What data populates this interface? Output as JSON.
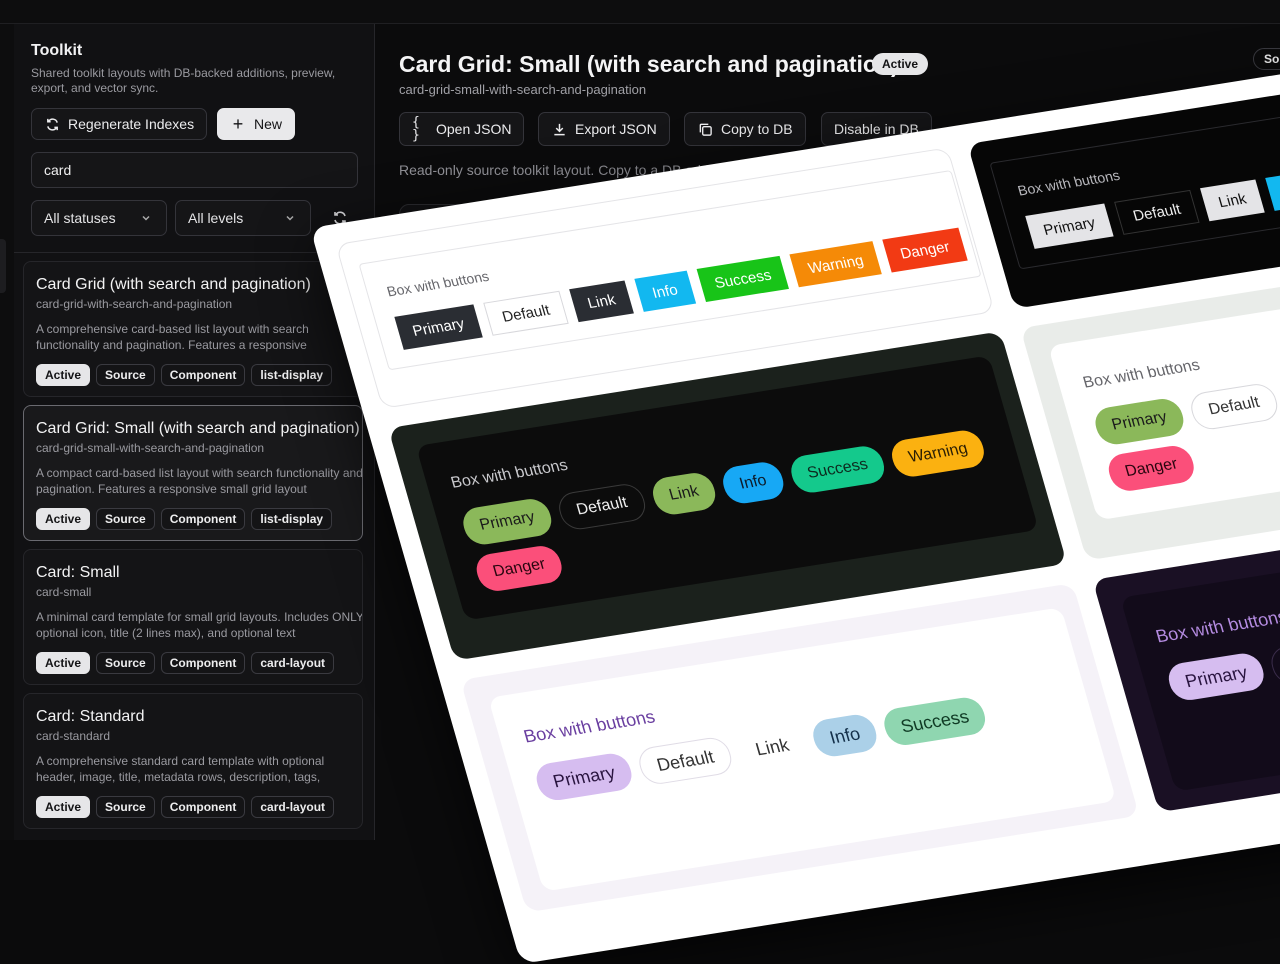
{
  "sidebar": {
    "title": "Toolkit",
    "description": "Shared toolkit layouts with DB-backed additions, preview, export, and vector sync.",
    "regenerate_label": "Regenerate Indexes",
    "new_label": "New",
    "search_value": "card",
    "status_filter": "All statuses",
    "level_filter": "All levels",
    "items": [
      {
        "title": "Card Grid (with search and pagination)",
        "slug": "card-grid-with-search-and-pagination",
        "desc": "A comprehensive card-based list layout with search functionality and pagination. Features a responsive",
        "tags": [
          "Active",
          "Source",
          "Component",
          "list-display"
        ]
      },
      {
        "title": "Card Grid: Small (with search and pagination)",
        "slug": "card-grid-small-with-search-and-pagination",
        "desc": "A compact card-based list layout with search functionality and pagination. Features a responsive small grid layout",
        "tags": [
          "Active",
          "Source",
          "Component",
          "list-display"
        ]
      },
      {
        "title": "Card: Small",
        "slug": "card-small",
        "desc": "A minimal card template for small grid layouts. Includes ONLY optional icon, title (2 lines max), and optional text",
        "tags": [
          "Active",
          "Source",
          "Component",
          "card-layout"
        ]
      },
      {
        "title": "Card: Standard",
        "slug": "card-standard",
        "desc": "A comprehensive standard card template with optional header, image, title, metadata rows, description, tags,",
        "tags": [
          "Active",
          "Source",
          "Component",
          "card-layout"
        ]
      }
    ]
  },
  "main": {
    "title": "Card Grid: Small (with search and pagination)",
    "status_badge": "Active",
    "source_badge": "Source",
    "slug": "card-grid-small-with-search-and-pagination",
    "actions": [
      {
        "label": "Open JSON",
        "icon": "braces-icon"
      },
      {
        "label": "Export JSON",
        "icon": "download-icon"
      },
      {
        "label": "Copy to DB",
        "icon": "copy-icon"
      },
      {
        "label": "Disable in DB",
        "icon": ""
      }
    ],
    "note": "Read-only source toolkit layout. Copy to a DB addition to make changes, or disable it in DB to hide it from AI and usage while keeping it v"
  },
  "preview": {
    "box_label": "Box with buttons",
    "buttons": [
      "Primary",
      "Default",
      "Link",
      "Info",
      "Success",
      "Warning",
      "Danger"
    ]
  },
  "colors": {
    "accent_light": "#e6e6e8",
    "info": "#12b8f0",
    "success": "#18c418",
    "warning": "#f58a07",
    "danger": "#f23a14"
  }
}
